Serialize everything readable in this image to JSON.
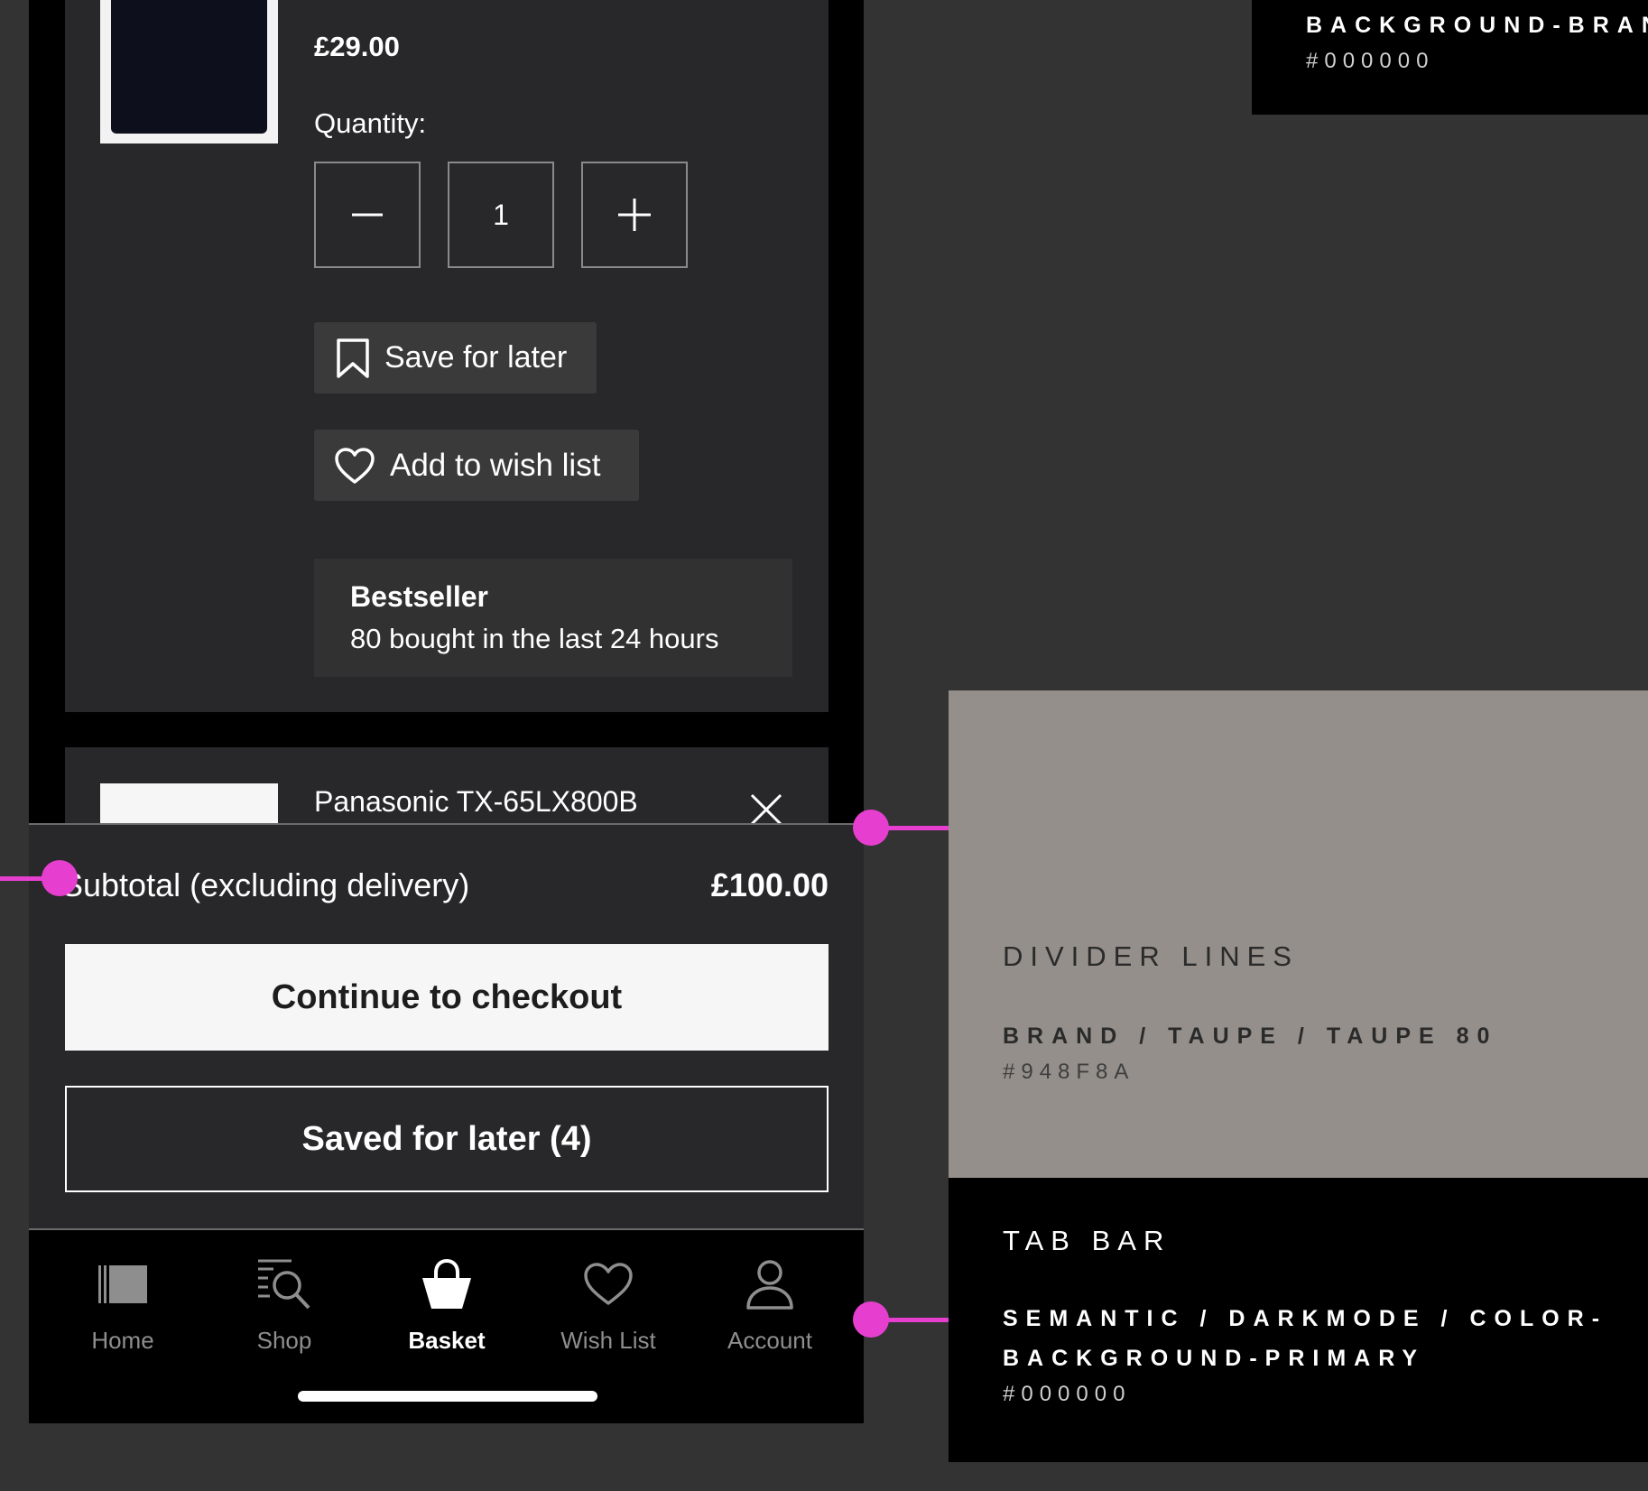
{
  "product1": {
    "price": "£29.00",
    "quantity_label": "Quantity:",
    "quantity": "1",
    "save_for_later": "Save for later",
    "add_to_wish_list": "Add to wish list",
    "badge_title": "Bestseller",
    "badge_text": "80 bought in the last 24 hours"
  },
  "product2": {
    "name": "Panasonic TX-65LX800B"
  },
  "summary": {
    "subtotal_label": "Subtotal (excluding delivery)",
    "subtotal_value": "£100.00",
    "checkout_label": "Continue to checkout",
    "saved_label": "Saved for later (4)"
  },
  "tabbar": {
    "items": [
      {
        "label": "Home",
        "icon": "home-icon"
      },
      {
        "label": "Shop",
        "icon": "search-list-icon"
      },
      {
        "label": "Basket",
        "icon": "basket-icon",
        "active": true
      },
      {
        "label": "Wish List",
        "icon": "heart-icon"
      },
      {
        "label": "Account",
        "icon": "person-icon"
      }
    ]
  },
  "swatches": {
    "top": {
      "token": "BACKGROUND-BRAN",
      "hex": "#000000"
    },
    "divider": {
      "title": "DIVIDER LINES",
      "token": "BRAND / TAUPE / TAUPE 80",
      "hex": "#948F8A"
    },
    "tabbar": {
      "title": "TAB BAR",
      "token_line1": "SEMANTIC / DARKMODE / COLOR-",
      "token_line2": "BACKGROUND-PRIMARY",
      "hex": "#000000"
    }
  },
  "colors": {
    "annotation": "#e63fd0",
    "taupe": "#948f8a",
    "card": "#282729",
    "canvas": "#333333"
  }
}
